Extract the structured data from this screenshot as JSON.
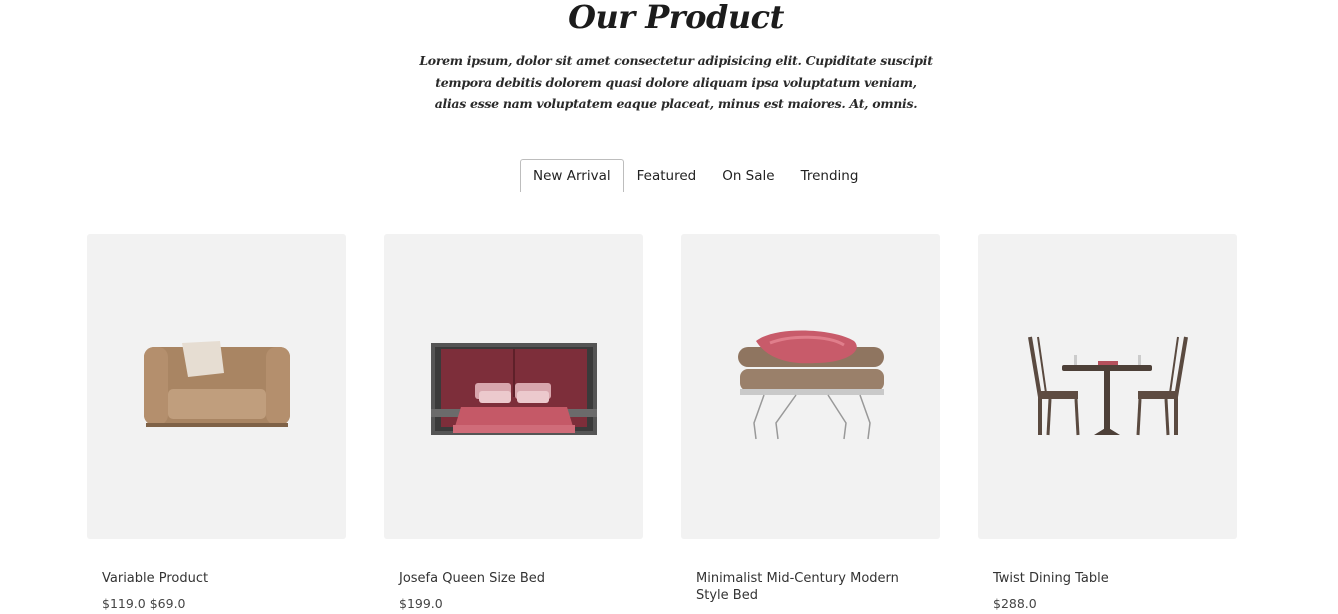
{
  "section": {
    "title": "Our Product",
    "description": "Lorem ipsum, dolor sit amet consectetur adipisicing elit. Cupiditate suscipit tempora debitis dolorem quasi dolore aliquam ipsa voluptatum veniam, alias esse nam voluptatem eaque placeat, minus est maiores. At, omnis."
  },
  "tabs": [
    {
      "label": "New Arrival",
      "active": true
    },
    {
      "label": "Featured",
      "active": false
    },
    {
      "label": "On Sale",
      "active": false
    },
    {
      "label": "Trending",
      "active": false
    }
  ],
  "products": [
    {
      "name": "Variable Product",
      "price": "$119.0 $69.0",
      "image": "armchair"
    },
    {
      "name": "Josefa Queen Size Bed",
      "price": "$199.0",
      "image": "bed"
    },
    {
      "name": "Minimalist Mid-Century Modern Style Bed",
      "price": "",
      "image": "lounge-bench"
    },
    {
      "name": "Twist Dining Table",
      "price": "$288.0",
      "image": "dining-set"
    }
  ],
  "colors": {
    "card_background": "#f2f2f2",
    "accent_red": "#b5505c"
  }
}
